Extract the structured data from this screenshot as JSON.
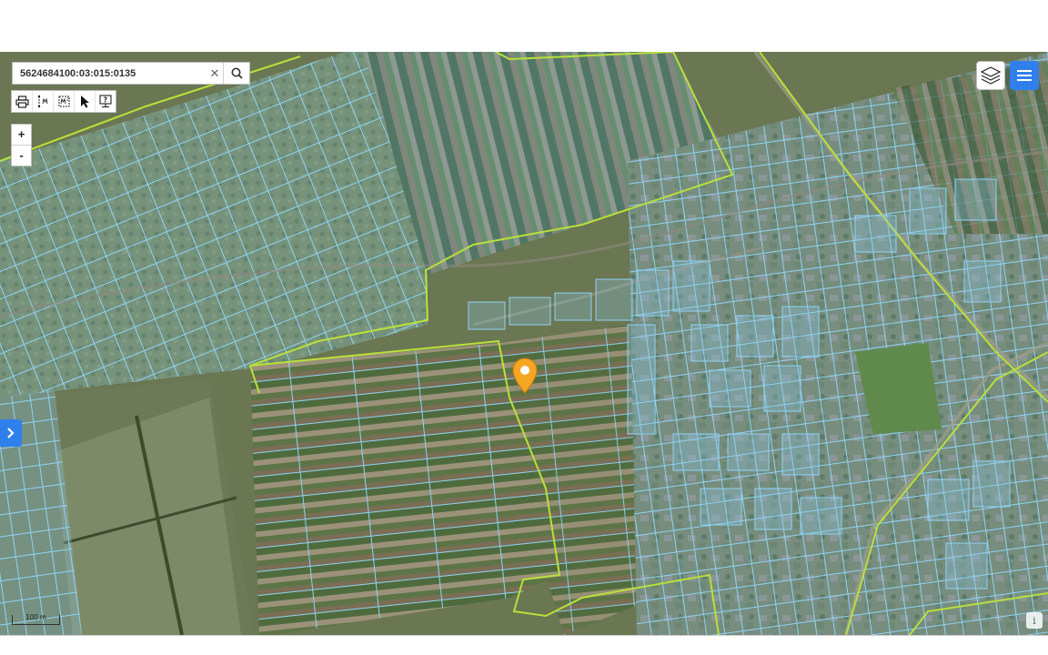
{
  "search": {
    "value": "5624684100:03:015:0135",
    "clear_label": "✕"
  },
  "zoom": {
    "in_label": "+",
    "out_label": "-"
  },
  "scale": {
    "label": "100 m"
  },
  "info": {
    "label": "i"
  },
  "colors": {
    "accent": "#2f80ed",
    "marker": "#f5a623",
    "boundary": "#b9e03a",
    "parcel": "#8fd3f5"
  },
  "icons": {
    "search": "search-icon",
    "clear": "close-icon",
    "print": "printer-icon",
    "measure_line": "measure-distance-icon",
    "measure_area": "measure-area-icon",
    "select": "cursor-icon",
    "info_query": "info-query-icon",
    "layers": "layers-icon",
    "menu": "hamburger-icon",
    "side_panel": "chevron-right-icon",
    "location": "map-pin-icon"
  }
}
